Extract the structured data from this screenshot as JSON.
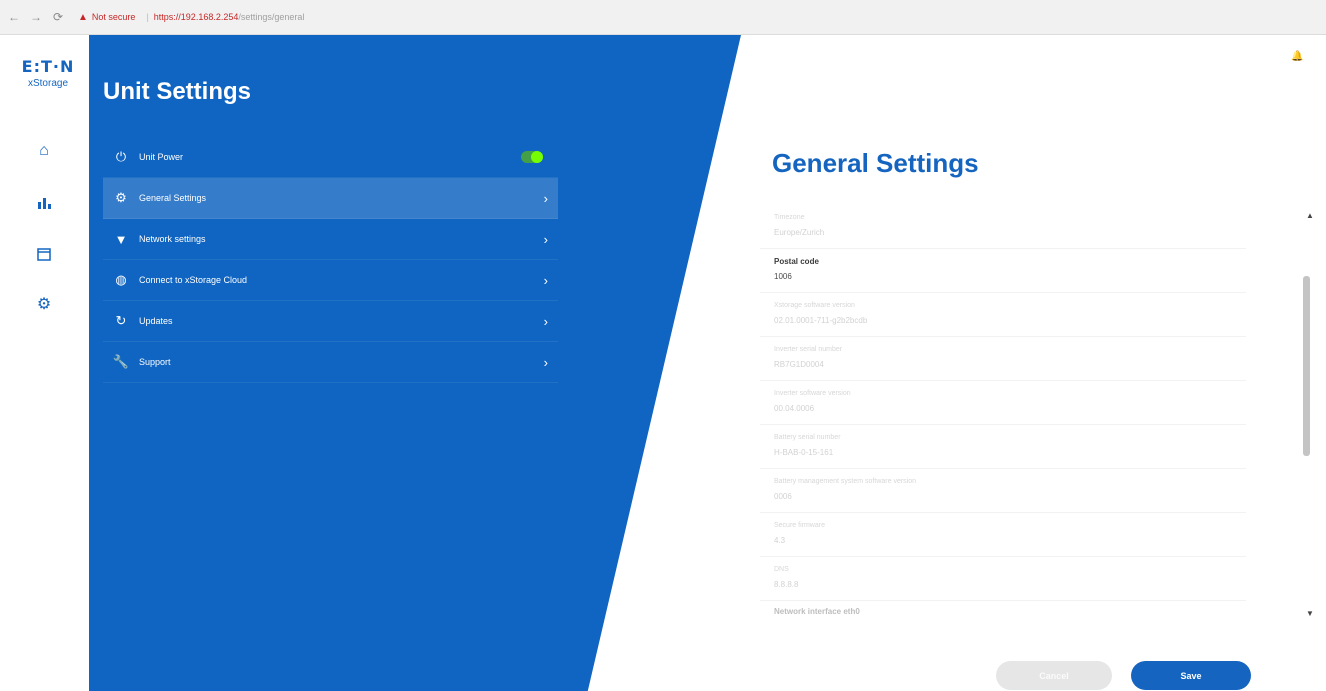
{
  "browser": {
    "not_secure": "Not secure",
    "https": "https://",
    "host": "192.168.2.254",
    "path": "/settings/general"
  },
  "sidebar": {
    "logo": "E:T·N",
    "logo_sub": "xStorage",
    "items": [
      {
        "icon": "home-icon",
        "label": ""
      },
      {
        "icon": "bar-chart-icon",
        "label": ""
      },
      {
        "icon": "calendar-icon",
        "label": ""
      },
      {
        "icon": "gear-icon",
        "label": ""
      }
    ]
  },
  "unit_settings": {
    "title": "Unit Settings",
    "menu": [
      {
        "icon": "power-icon",
        "label": "Unit Power"
      },
      {
        "icon": "gear-icon",
        "label": "General Settings"
      },
      {
        "icon": "wifi-icon",
        "label": "Network settings"
      },
      {
        "icon": "globe-icon",
        "label": "Connect to xStorage Cloud"
      },
      {
        "icon": "refresh-icon",
        "label": "Updates"
      },
      {
        "icon": "wrench-icon",
        "label": "Support"
      }
    ]
  },
  "general_settings": {
    "title": "General Settings",
    "fields": [
      {
        "label": "Timezone",
        "value": "Europe/Zurich"
      },
      {
        "label": "Postal code",
        "value": "1006"
      },
      {
        "label": "Xstorage software version",
        "value": "02.01.0001-711-g2b2bcdb"
      },
      {
        "label": "Inverter serial number",
        "value": "RB7G1D0004"
      },
      {
        "label": "Inverter software version",
        "value": "00.04.0006"
      },
      {
        "label": "Battery serial number",
        "value": "H-BAB-0-15-161"
      },
      {
        "label": "Battery management system software version",
        "value": "0006"
      },
      {
        "label": "Secure firmware",
        "value": "4.3"
      },
      {
        "label": "DNS",
        "value": "8.8.8.8"
      },
      {
        "label": "Network interface eth0",
        "value": ""
      }
    ],
    "cancel_label": "Cancel",
    "save_label": "Save"
  },
  "colors": {
    "brand_blue": "#0f65c1",
    "accent_blue": "#1565c0",
    "toggle_green": "#43a047"
  }
}
